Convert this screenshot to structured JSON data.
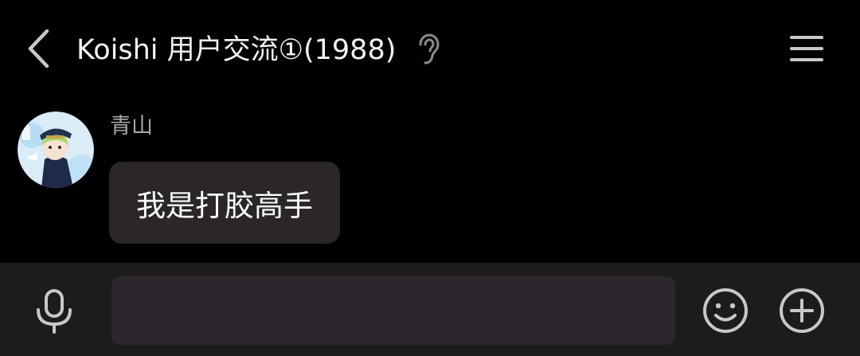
{
  "header": {
    "back_icon": "chevron-left-icon",
    "title": "Koishi 用户交流①(1988)",
    "ear_icon": "ear-icon",
    "menu_icon": "hamburger-menu-icon"
  },
  "messages": [
    {
      "sender": "青山",
      "text": "我是打胶高手",
      "avatar_icon": "avatar"
    }
  ],
  "input_bar": {
    "mic_icon": "microphone-icon",
    "input_value": "",
    "emoji_icon": "smiley-icon",
    "plus_icon": "plus-circle-icon"
  },
  "colors": {
    "background": "#000000",
    "bubble": "#2a2629",
    "input_bar": "#1d1b1d",
    "input_field": "#2c272c",
    "icon": "#c8c8c8",
    "sender_name": "#a8a8a8"
  }
}
